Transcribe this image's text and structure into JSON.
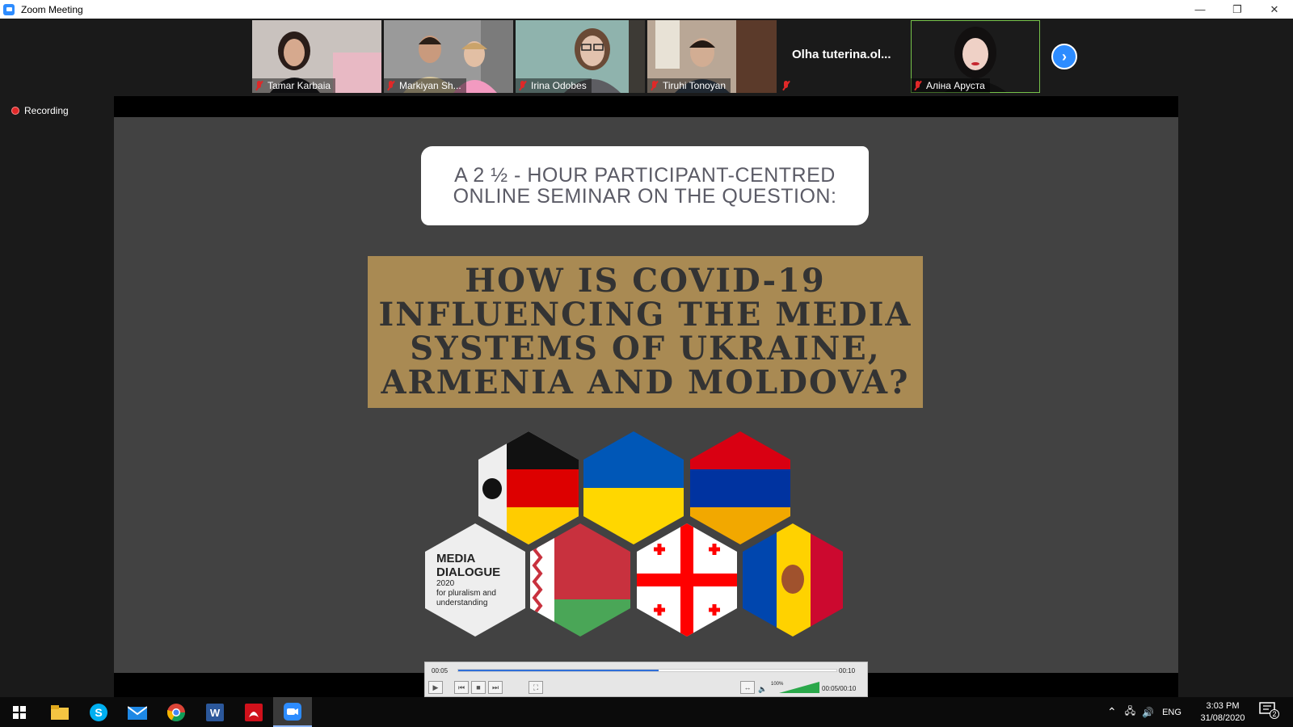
{
  "window": {
    "title": "Zoom Meeting"
  },
  "participants": [
    {
      "name": "Tamar Karbaia",
      "muted": true,
      "video": true
    },
    {
      "name": "Markiyan Sh...",
      "muted": true,
      "video": true
    },
    {
      "name": "Irina Odobes",
      "muted": true,
      "video": true
    },
    {
      "name": "Tiruhi Tonoyan",
      "muted": true,
      "video": true
    },
    {
      "name": "Olha  tuterina.ol...",
      "muted": true,
      "video": false
    },
    {
      "name": "Аліна Аруста",
      "muted": true,
      "video": true,
      "active_speaker": true
    }
  ],
  "recording": {
    "label": "Recording"
  },
  "slide": {
    "subtitle_lines": [
      "A 2 ½ - HOUR PARTICIPANT-CENTRED",
      "ONLINE SEMINAR ON THE QUESTION:"
    ],
    "title_lines": [
      "HOW IS COVID-19",
      "INFLUENCING THE MEDIA",
      "SYSTEMS OF UKRAINE,",
      "ARMENIA AND MOLDOVA?"
    ],
    "logo": {
      "line1": "MEDIA",
      "line2": "DIALOGUE",
      "line3": "2020",
      "line4": "for pluralism and",
      "line5": "understanding"
    },
    "flags": [
      "germany",
      "ukraine",
      "armenia",
      "belarus",
      "georgia",
      "moldova"
    ]
  },
  "player": {
    "elapsed": "00:05",
    "total": "00:10",
    "time_readout": "00:05/00:10",
    "progress_fraction": 0.53,
    "volume_label": "100%"
  },
  "taskbar": {
    "apps": [
      "windows-start",
      "file-explorer",
      "skype",
      "mail",
      "chrome",
      "word",
      "acrobat",
      "zoom"
    ],
    "language": "ENG",
    "time": "3:03 PM",
    "date": "31/08/2020",
    "notification_count": "2"
  },
  "colors": {
    "zoom_blue": "#2d8cff",
    "slide_bg": "#424242",
    "gold": "#a98a53",
    "record_red": "#e02828"
  }
}
